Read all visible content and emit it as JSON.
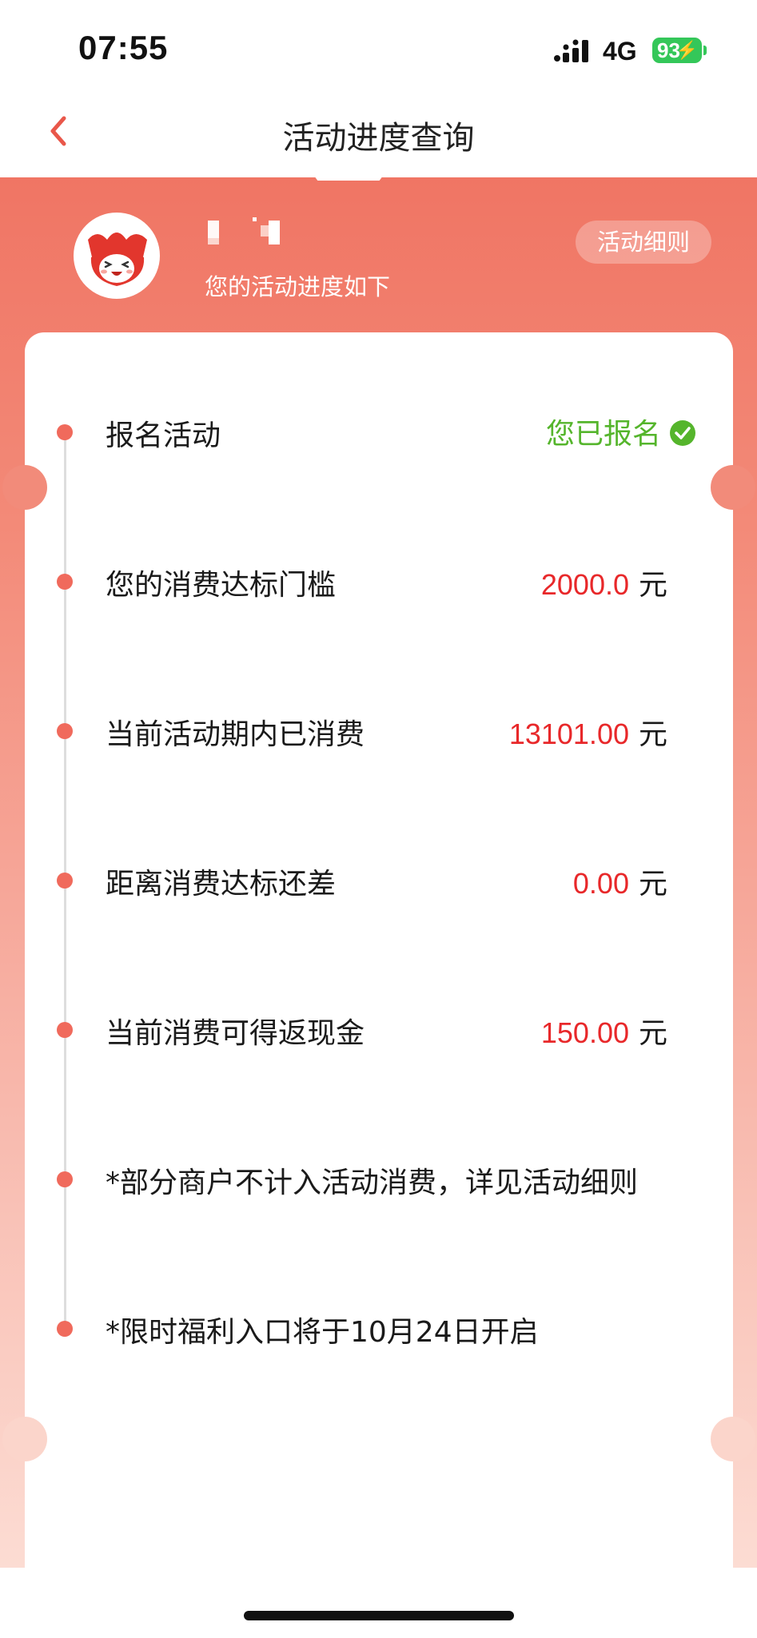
{
  "status_bar": {
    "time": "07:55",
    "network": "4G",
    "battery": "93"
  },
  "nav": {
    "title": "活动进度查询"
  },
  "header": {
    "subtitle": "您的活动进度如下",
    "rules_button": "活动细则"
  },
  "progress": {
    "items": [
      {
        "label": "报名活动",
        "status": "您已报名"
      },
      {
        "label": "您的消费达标门槛",
        "value": "2000.0",
        "unit": "元"
      },
      {
        "label": "当前活动期内已消费",
        "value": "13101.00",
        "unit": "元"
      },
      {
        "label": "距离消费达标还差",
        "value": "0.00",
        "unit": "元"
      },
      {
        "label": "当前消费可得返现金",
        "value": "150.00",
        "unit": "元"
      },
      {
        "label": "*部分商户不计入活动消费，详见活动细则"
      },
      {
        "label": "*限时福利入口将于10月24日开启"
      }
    ]
  },
  "colors": {
    "accent_red": "#e8282a",
    "success_green": "#55b52c",
    "banner_top": "#f07564",
    "dot": "#f06a5c"
  }
}
